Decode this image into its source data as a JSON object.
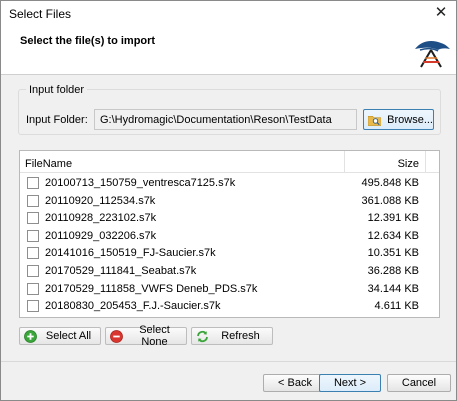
{
  "window": {
    "title": "Select Files",
    "close_glyph": "✕"
  },
  "header": {
    "heading": "Select the file(s) to import",
    "logo_icon": "hydromagic-logo"
  },
  "input_folder": {
    "group_label": "Input folder",
    "label": "Input Folder:",
    "value": "G:\\Hydromagic\\Documentation\\Reson\\TestData",
    "browse_label": "Browse..."
  },
  "file_list": {
    "columns": {
      "name": "FileName",
      "size": "Size"
    },
    "rows": [
      {
        "name": "20100713_150759_ventresca7125.s7k",
        "size": "495.848 KB",
        "checked": false
      },
      {
        "name": "20110920_112534.s7k",
        "size": "361.088 KB",
        "checked": false
      },
      {
        "name": "20110928_223102.s7k",
        "size": "12.391 KB",
        "checked": false
      },
      {
        "name": "20110929_032206.s7k",
        "size": "12.634 KB",
        "checked": false
      },
      {
        "name": "20141016_150519_FJ-Saucier.s7k",
        "size": "10.351 KB",
        "checked": false
      },
      {
        "name": "20170529_111841_Seabat.s7k",
        "size": "36.288 KB",
        "checked": false
      },
      {
        "name": "20170529_111858_VWFS Deneb_PDS.s7k",
        "size": "34.144 KB",
        "checked": false
      },
      {
        "name": "20180830_205453_F.J.-Saucier.s7k",
        "size": "4.611 KB",
        "checked": false
      }
    ]
  },
  "actions": {
    "select_all": "Select All",
    "select_none": "Select None",
    "refresh": "Refresh"
  },
  "navigation": {
    "back": "< Back",
    "next": "Next >",
    "cancel": "Cancel"
  },
  "colors": {
    "accent": "#3c7fb1",
    "select_all_icon": "#3aa53a",
    "select_none_icon": "#d9362f",
    "refresh_icon": "#3aa53a"
  }
}
